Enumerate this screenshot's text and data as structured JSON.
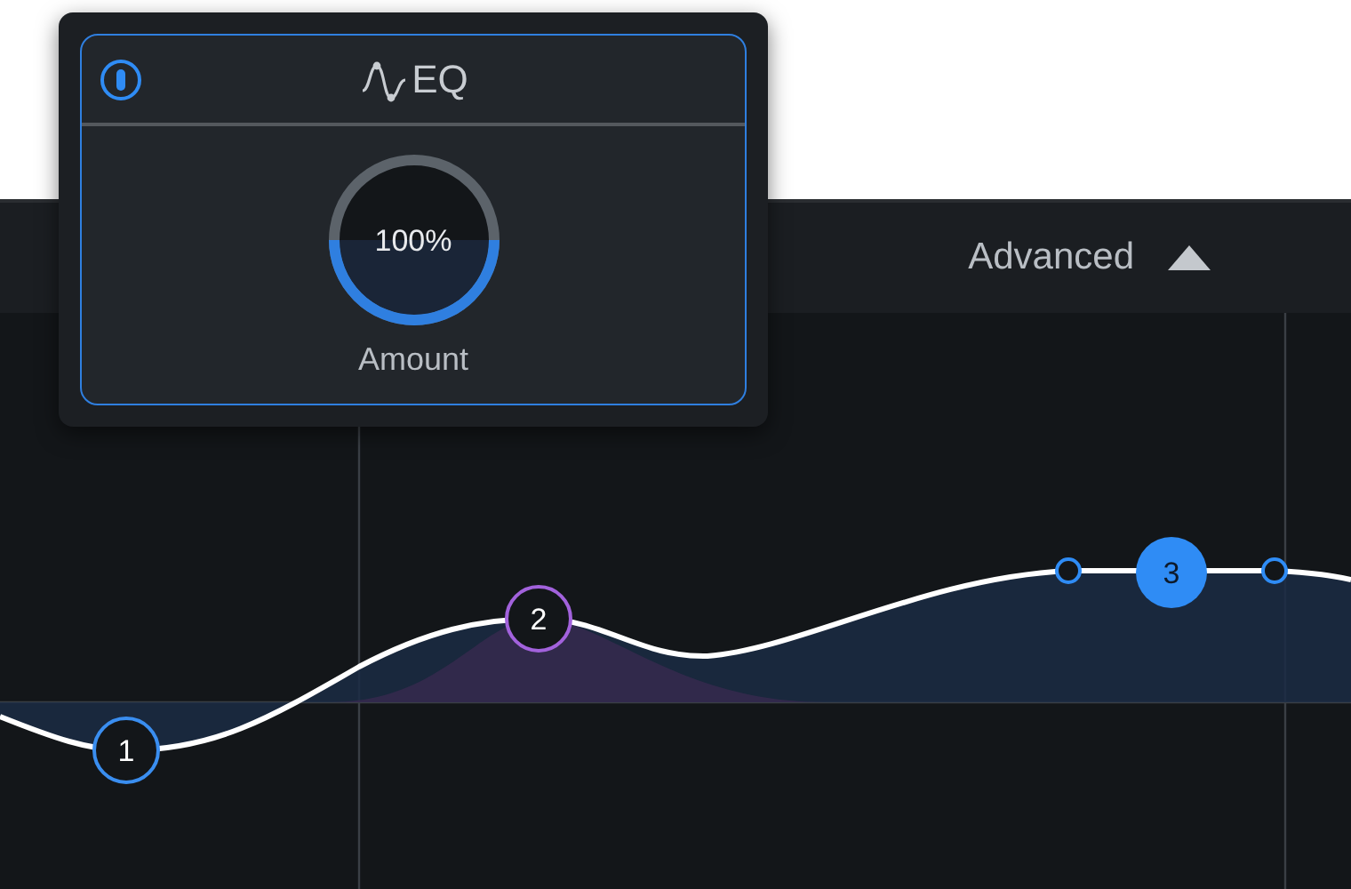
{
  "header": {
    "toggle": "Advanced",
    "expanded": true
  },
  "popup": {
    "power_on": true,
    "title": "EQ",
    "knob": {
      "reading": "100%",
      "label": "Amount"
    }
  },
  "eq_nodes": [
    {
      "label": "1",
      "selected": false,
      "color": "#3a8ef0"
    },
    {
      "label": "2",
      "selected": false,
      "color": "#a262dc"
    },
    {
      "label": "3",
      "selected": true,
      "color": "#2f8cf5"
    }
  ]
}
